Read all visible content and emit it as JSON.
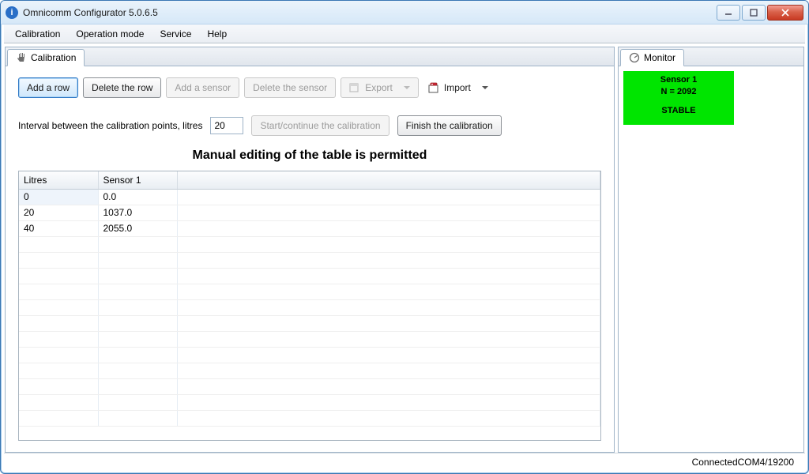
{
  "window": {
    "title": "Omnicomm Configurator 5.0.6.5"
  },
  "menubar": {
    "items": [
      "Calibration",
      "Operation mode",
      "Service",
      "Help"
    ]
  },
  "left": {
    "tab": {
      "label": "Calibration"
    },
    "toolbar": {
      "add_row": "Add a row",
      "delete_row": "Delete the row",
      "add_sensor": "Add a sensor",
      "delete_sensor": "Delete the sensor",
      "export": "Export",
      "import": "Import"
    },
    "row2": {
      "interval_label": "Interval between the calibration points, litres",
      "interval_value": "20",
      "start_continue": "Start/continue the calibration",
      "finish": "Finish the calibration"
    },
    "heading": "Manual editing of the table is permitted",
    "table": {
      "headers": {
        "col0": "Litres",
        "col1": "Sensor 1"
      },
      "rows": [
        {
          "litres": "0",
          "sensor1": "0.0"
        },
        {
          "litres": "20",
          "sensor1": "1037.0"
        },
        {
          "litres": "40",
          "sensor1": "2055.0"
        }
      ]
    }
  },
  "right": {
    "tab": {
      "label": "Monitor"
    },
    "sensor": {
      "name": "Sensor 1",
      "n_line": "N = 2092",
      "status": "STABLE"
    }
  },
  "statusbar": {
    "text": "ConnectedCOM4/19200"
  }
}
